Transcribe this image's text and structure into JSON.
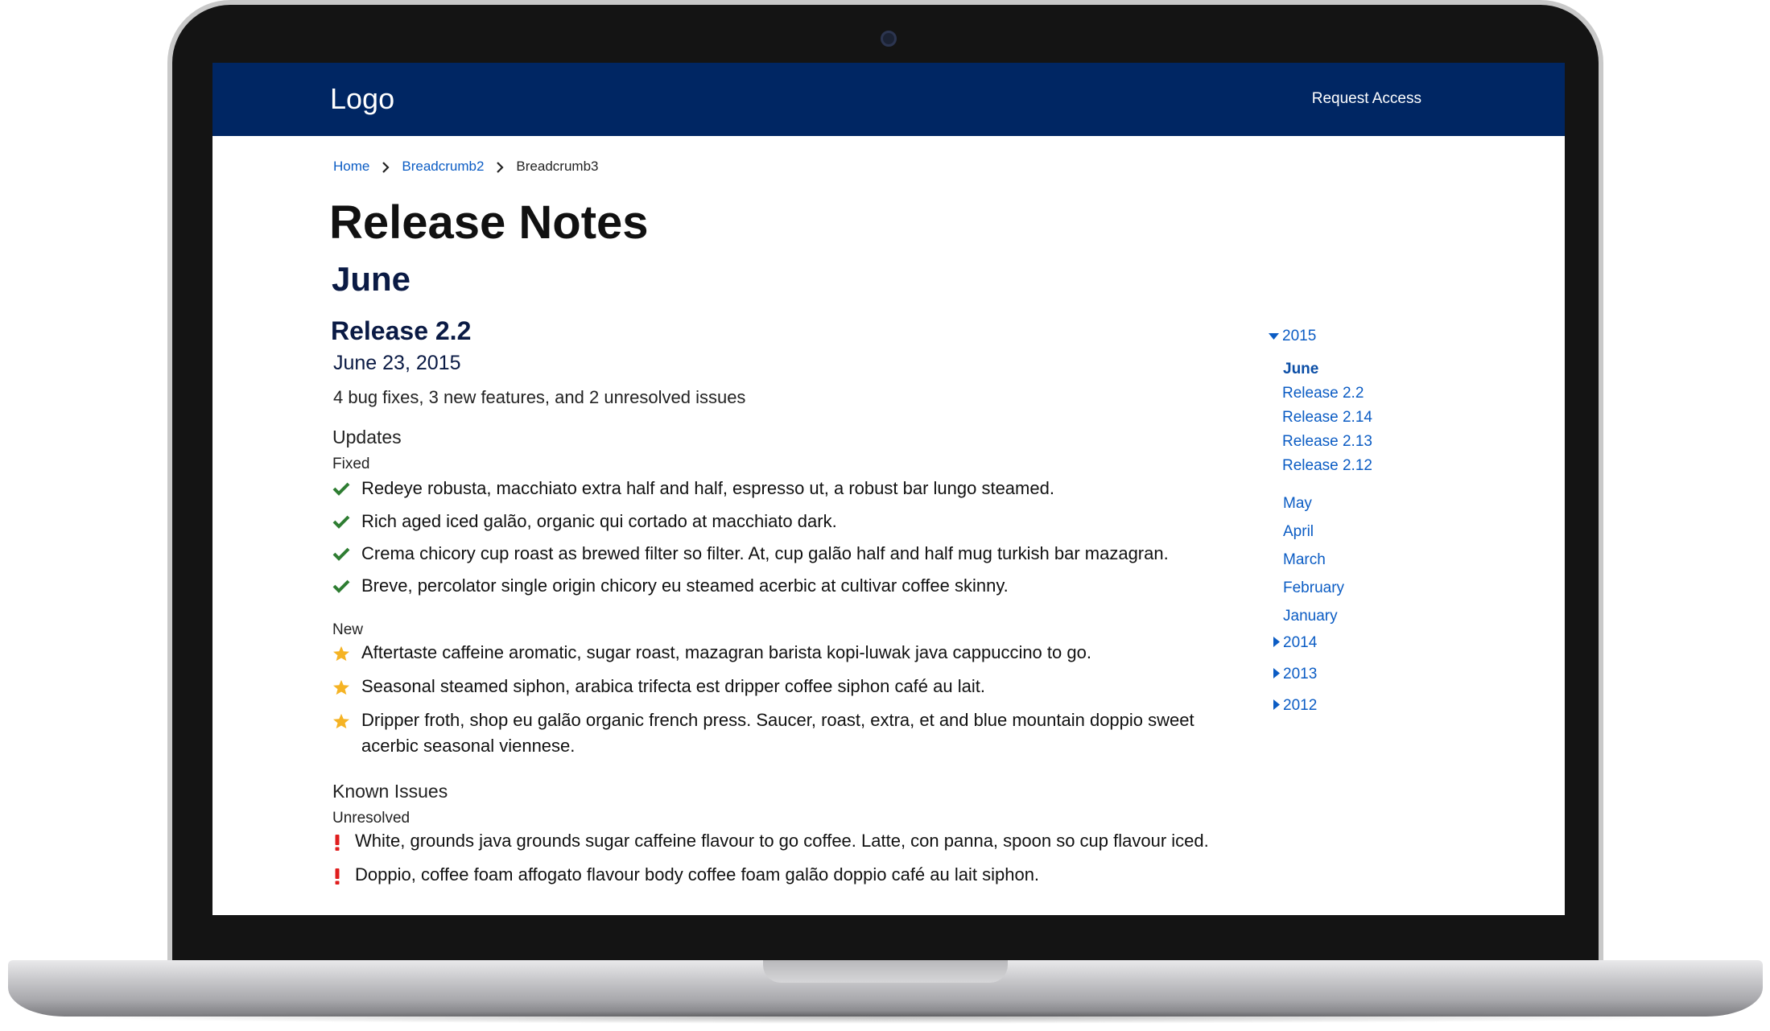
{
  "header": {
    "logo": "Logo",
    "request_access": "Request Access"
  },
  "breadcrumb": [
    "Home",
    "Breadcrumb2",
    "Breadcrumb3"
  ],
  "page": {
    "title": "Release Notes",
    "month": "June",
    "release_title": "Release 2.2",
    "release_date": "June 23, 2015",
    "summary": "4 bug fixes, 3 new features, and 2 unresolved issues"
  },
  "updates": {
    "heading": "Updates",
    "fixed_label": "Fixed",
    "fixed": [
      "Redeye robusta, macchiato extra half and half, espresso ut, a robust bar lungo steamed.",
      "Rich aged iced galão, organic qui cortado at macchiato dark.",
      "Crema chicory cup roast as brewed filter so filter. At, cup galão half and half mug turkish bar mazagran.",
      "Breve, percolator single origin chicory eu steamed acerbic at cultivar coffee skinny."
    ],
    "new_label": "New",
    "new": [
      "Aftertaste caffeine aromatic, sugar roast, mazagran barista kopi-luwak java cappuccino to go.",
      "Seasonal steamed siphon, arabica trifecta est dripper coffee siphon café au lait.",
      "Dripper froth, shop eu galão organic french press. Saucer, roast, extra, et and blue mountain doppio sweet acerbic seasonal viennese."
    ]
  },
  "known_issues": {
    "heading": "Known Issues",
    "unresolved_label": "Unresolved",
    "unresolved": [
      "White, grounds java grounds sugar caffeine flavour to go coffee. Latte, con panna, spoon so cup flavour iced.",
      "Doppio, coffee foam affogato flavour body coffee foam galão doppio café au lait siphon."
    ]
  },
  "sidebar": {
    "year_2015": "2015",
    "current_month": "June",
    "releases": [
      "Release 2.2",
      "Release 2.14",
      "Release 2.13",
      "Release 2.12"
    ],
    "months": [
      "May",
      "April",
      "March",
      "February",
      "January"
    ],
    "other_years": [
      "2014",
      "2013",
      "2012"
    ]
  },
  "colors": {
    "header_bg": "#002663",
    "link": "#0b5cc4",
    "check": "#2e7d32",
    "star": "#f5b324",
    "issue": "#e01e1e"
  },
  "icons": {
    "fixed": "check-icon",
    "new": "star-icon",
    "unresolved": "exclamation-icon",
    "expanded": "caret-down-icon",
    "collapsed": "caret-right-icon",
    "separator": "chevron-right-icon"
  }
}
